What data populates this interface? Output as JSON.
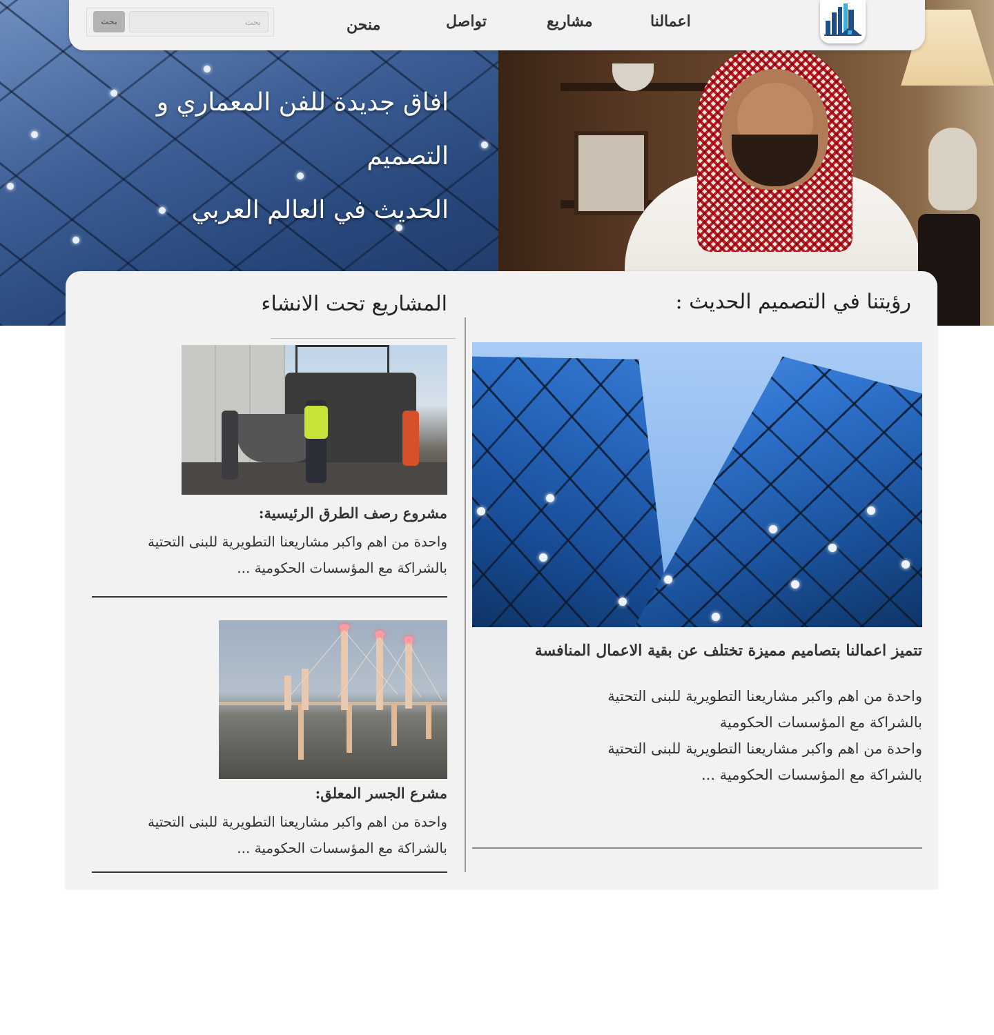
{
  "nav": {
    "links": [
      "اعمالنا",
      "مشاريع",
      "تواصل",
      "منحن"
    ],
    "search": {
      "placeholder": "بحث",
      "button_label": "بحث"
    }
  },
  "hero": {
    "title_line1": "افاق جديدة للفن المعماري و  التصميم",
    "title_line2": "الحديث في العالم العربي"
  },
  "vision": {
    "heading": "رؤيتنا في التصميم الحديث :",
    "subheading": "تتميز اعمالنا بتصاميم مميزة تختلف عن بقية الاعمال المنافسة",
    "body_lines": [
      "واحدة من اهم  واكبر مشاريعنا التطويرية  للبنى التحتية",
      "بالشراكة مع المؤسسات الحكومية",
      "واحدة من اهم  واكبر مشاريعنا التطويرية  للبنى التحتية",
      "بالشراكة مع المؤسسات الحكومية ..."
    ]
  },
  "projects": {
    "heading": "المشاريع تحت الانشاء",
    "items": [
      {
        "title": "مشروع رصف الطرق الرئيسية:",
        "line1": "واحدة من اهم  واكبر مشاريعنا التطويرية  للبنى التحتية",
        "line2": "بالشراكة مع المؤسسات الحكومية ..."
      },
      {
        "title": "مشرع الجسر المعلق:",
        "line1": "واحدة من اهم  واكبر مشاريعنا التطويرية  للبنى التحتية",
        "line2": "بالشراكة مع المؤسسات الحكومية ..."
      }
    ]
  },
  "colors": {
    "panel": "#f2f2f2",
    "nav": "#f2f2f2",
    "logo_primary": "#1f4f86",
    "logo_accent": "#3ab0d8"
  }
}
